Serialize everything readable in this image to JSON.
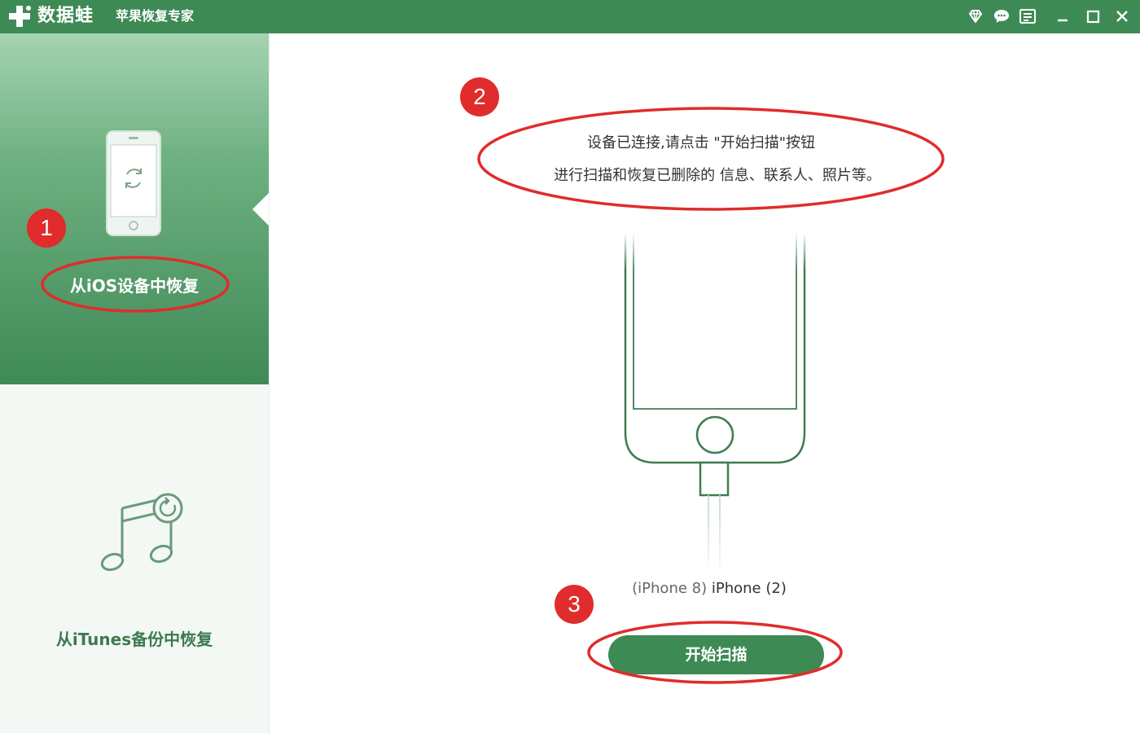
{
  "titlebar": {
    "app_name": "数据蛙",
    "app_subtitle": "苹果恢复专家",
    "icons": [
      "diamond-icon",
      "chat-icon",
      "menu-icon",
      "minimize-icon",
      "maximize-icon",
      "close-icon"
    ]
  },
  "sidebar": {
    "items": [
      {
        "label": "从iOS设备中恢复",
        "icon": "phone-icon",
        "active": true
      },
      {
        "label": "从iTunes备份中恢复",
        "icon": "music-note-icon",
        "active": false
      }
    ]
  },
  "main": {
    "instruction_line1": "设备已连接,请点击 \"开始扫描\"按钮",
    "instruction_line2": "进行扫描和恢复已删除的 信息、联系人、照片等。",
    "device_model": "(iPhone 8)",
    "device_name": "iPhone (2)",
    "scan_button_label": "开始扫描"
  },
  "annotations": {
    "badge_1": "1",
    "badge_2": "2",
    "badge_3": "3"
  },
  "colors": {
    "brand_green": "#3e8a55",
    "annotation_red": "#e02c2c"
  }
}
